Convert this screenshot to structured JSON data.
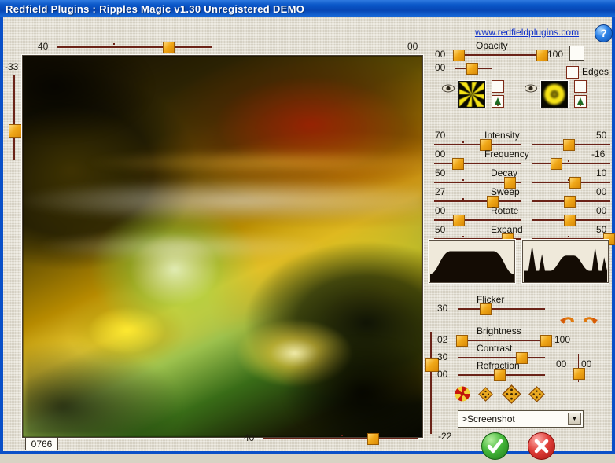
{
  "window": {
    "title": "Redfield Plugins : Ripples Magic v1.30   Unregistered  DEMO"
  },
  "header": {
    "website": "www.redfieldplugins.com",
    "help_glyph": "?"
  },
  "preview": {
    "top_ruler": {
      "left_value": "40",
      "right_value": "00"
    },
    "bottom_ruler": {
      "left_value": "40",
      "right_value": "-22"
    },
    "left_ruler": {
      "value": "-33"
    },
    "position_value": "0766"
  },
  "opacity": {
    "label": "Opacity",
    "row1_left": "00",
    "row1_right": "100",
    "row2_left": "00",
    "edges_label": "Edges"
  },
  "patterns": {
    "left_icon": "starburst-pattern",
    "right_icon": "concentric-ring-pattern",
    "eye_icon": "eye-icon",
    "blank_icon": "blank-swatch-icon",
    "tree_icon": "tree-icon"
  },
  "sliders": [
    {
      "name": "intensity",
      "label": "Intensity",
      "left": "70",
      "right": "50",
      "left_pos": 0.58,
      "right_pos": 0.46
    },
    {
      "name": "frequency",
      "label": "Frequency",
      "left": "00",
      "right": "-16",
      "left_pos": 0.26,
      "right_pos": 0.3
    },
    {
      "name": "decay",
      "label": "Decay",
      "left": "50",
      "right": "10",
      "left_pos": 0.86,
      "right_pos": 0.54
    },
    {
      "name": "sweep",
      "label": "Sweep",
      "left": "27",
      "right": "00",
      "left_pos": 0.66,
      "right_pos": 0.47
    },
    {
      "name": "rotate",
      "label": "Rotate",
      "left": "00",
      "right": "00",
      "left_pos": 0.27,
      "right_pos": 0.47
    },
    {
      "name": "expand",
      "label": "Expand",
      "left": "50",
      "right": "50",
      "left_pos": 0.84,
      "right_pos": 0.97
    }
  ],
  "lower_sliders": [
    {
      "name": "flicker",
      "label": "Flicker",
      "left": "30",
      "right": "",
      "pos": 0.3
    },
    {
      "name": "brightness",
      "label": "Brightness",
      "left": "02",
      "right": "100",
      "pos": 0.03
    },
    {
      "name": "contrast",
      "label": "Contrast",
      "left": "30",
      "right": "",
      "pos": 0.72
    },
    {
      "name": "refraction",
      "label": "Refraction",
      "left": "00",
      "right": "",
      "pos": 0.46
    }
  ],
  "xy_pad": {
    "x_value": "00",
    "y_value": "00"
  },
  "undo_redo": {
    "undo_icon": "undo-arrow-icon",
    "redo_icon": "redo-arrow-icon"
  },
  "presets": [
    {
      "name": "preset-pinwheel",
      "icon": "pinwheel-icon"
    },
    {
      "name": "preset-diamond-small",
      "icon": "diamond-icon"
    },
    {
      "name": "preset-diamond-large",
      "icon": "diamond-icon"
    },
    {
      "name": "preset-diamond-medium",
      "icon": "diamond-icon"
    }
  ],
  "preset_select": {
    "value": ">Screenshot",
    "arrow_glyph": "▼"
  },
  "actions": {
    "ok_glyph": "✔",
    "cancel_glyph": "✖"
  },
  "colors": {
    "title_bar": "#0a57c8",
    "panel": "#e3ded0",
    "track": "#6b2318",
    "knob": "#f0a818",
    "link": "#1434c8",
    "ok": "#46b83a",
    "cancel": "#e0403a"
  }
}
